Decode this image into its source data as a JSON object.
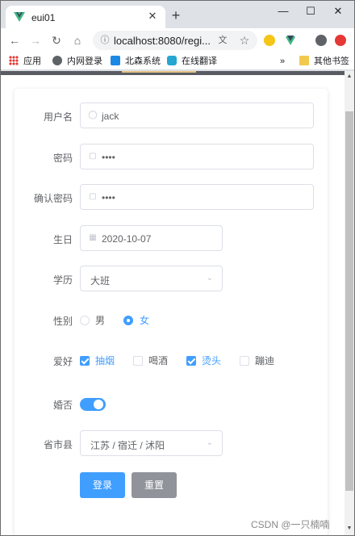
{
  "browser": {
    "tab_title": "eui01",
    "new_tab": "+",
    "url": "localhost:8080/regi...",
    "bookmarks": [
      {
        "label": "应用",
        "icon": "apps-grid-icon"
      },
      {
        "label": "内网登录",
        "icon": "globe-icon"
      },
      {
        "label": "北森系统",
        "icon": "bookmark-i-icon"
      },
      {
        "label": "在线翻译",
        "icon": "bookmark-d-icon"
      }
    ],
    "bookmarks_more": "»",
    "other_bookmarks": "其他书签"
  },
  "form": {
    "username": {
      "label": "用户名",
      "value": "jack"
    },
    "password": {
      "label": "密码",
      "value": "••••"
    },
    "confirm_password": {
      "label": "确认密码",
      "value": "••••"
    },
    "birthday": {
      "label": "生日",
      "value": "2020-10-07"
    },
    "education": {
      "label": "学历",
      "value": "大班"
    },
    "gender": {
      "label": "性别",
      "options": [
        {
          "label": "男",
          "selected": false
        },
        {
          "label": "女",
          "selected": true
        }
      ]
    },
    "hobbies": {
      "label": "爱好",
      "options": [
        {
          "label": "抽烟",
          "checked": true
        },
        {
          "label": "喝酒",
          "checked": false
        },
        {
          "label": "烫头",
          "checked": true
        },
        {
          "label": "蹦迪",
          "checked": false
        }
      ]
    },
    "married": {
      "label": "婚否",
      "on": true
    },
    "region": {
      "label": "省市县",
      "value": "江苏 / 宿迁 / 沭阳"
    },
    "submit_label": "登录",
    "reset_label": "重置"
  },
  "watermark": "CSDN @一只楠喃",
  "colors": {
    "primary": "#409eff",
    "info": "#909399",
    "vue_green": "#41b883"
  }
}
